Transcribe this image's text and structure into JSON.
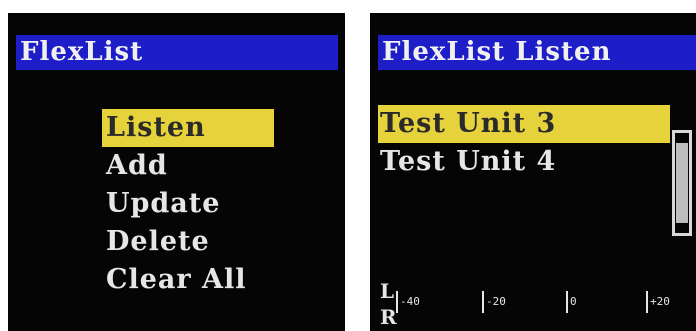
{
  "left_screen": {
    "title": "FlexList",
    "menu": [
      {
        "label": "Listen",
        "selected": true
      },
      {
        "label": "Add",
        "selected": false
      },
      {
        "label": "Update",
        "selected": false
      },
      {
        "label": "Delete",
        "selected": false
      },
      {
        "label": "Clear All",
        "selected": false
      }
    ]
  },
  "right_screen": {
    "title": "FlexList Listen",
    "items": [
      {
        "label": "Test Unit 3",
        "selected": true
      },
      {
        "label": "Test Unit 4",
        "selected": false
      }
    ],
    "meter": {
      "left_label": "L",
      "right_label": "R",
      "ticks": [
        "-40",
        "-20",
        "0",
        "+20"
      ]
    }
  },
  "colors": {
    "title_bar": "#1e1ec8",
    "highlight": "#e6d23a",
    "screen_bg": "#050505",
    "text": "#e6e6e6"
  }
}
